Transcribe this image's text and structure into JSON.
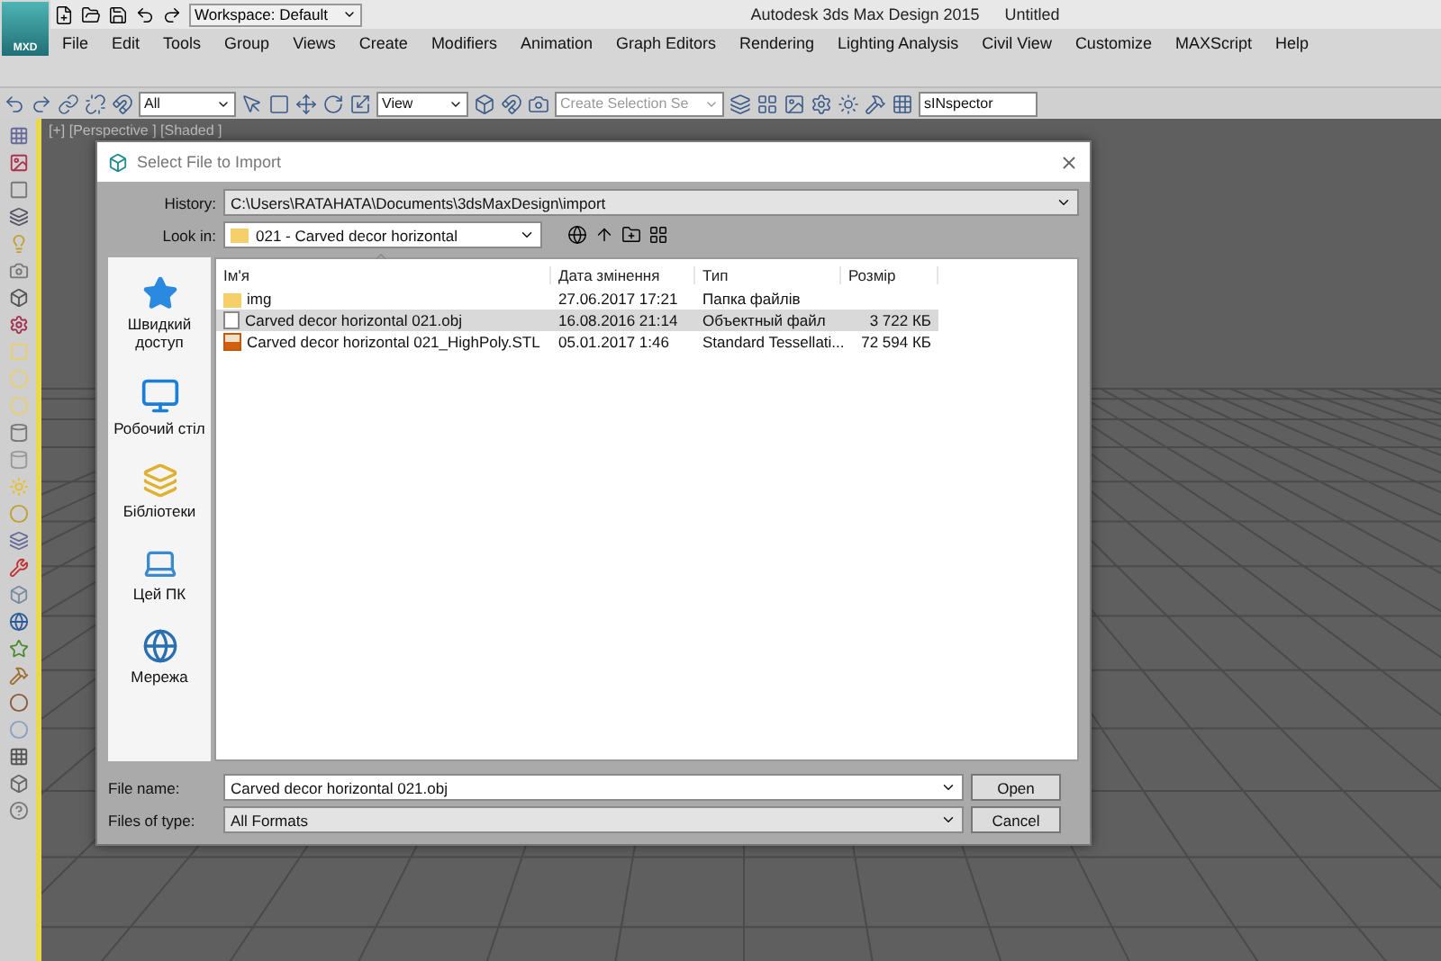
{
  "title_bar": {
    "app_badge": "MXD",
    "workspace": "Workspace: Default",
    "title": "Autodesk 3ds Max Design 2015",
    "document": "Untitled"
  },
  "menu": [
    "File",
    "Edit",
    "Tools",
    "Group",
    "Views",
    "Create",
    "Modifiers",
    "Animation",
    "Graph Editors",
    "Rendering",
    "Lighting Analysis",
    "Civil View",
    "Customize",
    "MAXScript",
    "Help"
  ],
  "toolbar": {
    "selection_filter": "All",
    "reference_coord": "View",
    "named_selection_placeholder": "Create Selection Se",
    "inspector": "sINspector"
  },
  "viewport": {
    "label": "[+] [Perspective ] [Shaded ]"
  },
  "dialog": {
    "title": "Select File to Import",
    "history_label": "History:",
    "history_value": "C:\\Users\\RATAHATA\\Documents\\3dsMaxDesign\\import",
    "look_in_label": "Look in:",
    "look_in_value": "021 - Carved decor horizontal",
    "places": [
      {
        "kind": "quick",
        "label": "Швидкий доступ"
      },
      {
        "kind": "desktop",
        "label": "Робочий стіл"
      },
      {
        "kind": "libraries",
        "label": "Бібліотеки"
      },
      {
        "kind": "pc",
        "label": "Цей ПК"
      },
      {
        "kind": "network",
        "label": "Мережа"
      }
    ],
    "columns": [
      "Ім'я",
      "Дата змінення",
      "Тип",
      "Розмір"
    ],
    "rows": [
      {
        "kind": "folder",
        "selected": false,
        "name": "img",
        "date": "27.06.2017 17:21",
        "type": "Папка файлів",
        "size": ""
      },
      {
        "kind": "file",
        "selected": true,
        "name": "Carved decor horizontal 021.obj",
        "date": "16.08.2016 21:14",
        "type": "Объектный файл",
        "size": "3 722 КБ"
      },
      {
        "kind": "stl",
        "selected": false,
        "name": "Carved decor horizontal 021_HighPoly.STL",
        "date": "05.01.2017 1:46",
        "type": "Standard Tessellati...",
        "size": "72 594 КБ"
      }
    ],
    "file_name_label": "File name:",
    "file_name_value": "Carved decor horizontal 021.obj",
    "file_type_label": "Files of type:",
    "file_type_value": "All Formats",
    "buttons": [
      "Open",
      "Cancel"
    ]
  }
}
